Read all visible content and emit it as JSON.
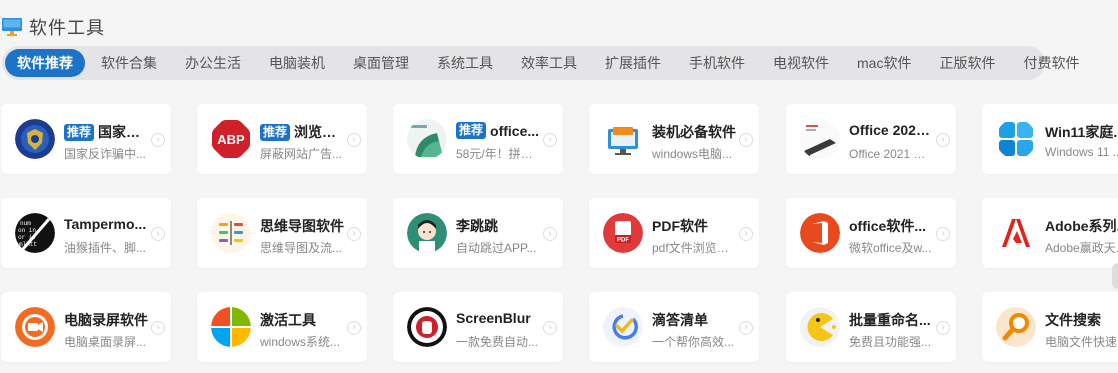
{
  "section": {
    "title": "软件工具",
    "icon": "monitor-icon"
  },
  "tabs": [
    "软件推荐",
    "软件合集",
    "办公生活",
    "电脑装机",
    "桌面管理",
    "系统工具",
    "效率工具",
    "扩展插件",
    "手机软件",
    "电视软件",
    "mac软件",
    "正版软件",
    "付费软件"
  ],
  "active_tab": "软件推荐",
  "accent_color": "#1c73c8",
  "cards": [
    {
      "name": "国家反...",
      "desc": "国家反诈骗中...",
      "badge": "推荐",
      "icon": "anti-fraud-shield-icon"
    },
    {
      "name": "浏览器...",
      "desc": "屏蔽网站广告...",
      "badge": "推荐",
      "icon": "adblock-plus-icon"
    },
    {
      "name": "office...",
      "desc": "58元/年！拼团...",
      "badge": "推荐",
      "icon": "microsoft-365-icon"
    },
    {
      "name": "装机必备软件",
      "desc": "windows电脑...",
      "badge": "",
      "icon": "toolbox-monitor-icon"
    },
    {
      "name": "Office 2021...",
      "desc": "Office 2021 家...",
      "badge": "",
      "icon": "office-box-icon"
    },
    {
      "name": "Win11家庭...",
      "desc": "Windows 11 ...",
      "badge": "",
      "icon": "windows-logo-icon"
    },
    {
      "name": "Tampermo...",
      "desc": "油猴插件、脚...",
      "badge": "",
      "icon": "tampermonkey-icon"
    },
    {
      "name": "思维导图软件",
      "desc": "思维导图及流...",
      "badge": "",
      "icon": "mind-map-icon"
    },
    {
      "name": "李跳跳",
      "desc": "自动跳过APP...",
      "badge": "",
      "icon": "avatar-girl-icon"
    },
    {
      "name": "PDF软件",
      "desc": "pdf文件浏览编...",
      "badge": "",
      "icon": "pdf-icon"
    },
    {
      "name": "office软件...",
      "desc": "微软office及w...",
      "badge": "",
      "icon": "office-logo-icon"
    },
    {
      "name": "Adobe系列...",
      "desc": "Adobe赢政天...",
      "badge": "",
      "icon": "adobe-logo-icon"
    },
    {
      "name": "电脑录屏软件",
      "desc": "电脑桌面录屏...",
      "badge": "",
      "icon": "screen-recorder-icon"
    },
    {
      "name": "激活工具",
      "desc": "windows系统...",
      "badge": "",
      "icon": "windows-color-icon"
    },
    {
      "name": "ScreenBlur",
      "desc": "一款免费自动...",
      "badge": "",
      "icon": "screenblur-stop-icon"
    },
    {
      "name": "滴答清单",
      "desc": "一个帮你高效...",
      "badge": "",
      "icon": "checkmark-icon"
    },
    {
      "name": "批量重命名...",
      "desc": "免费且功能强...",
      "badge": "",
      "icon": "pacman-icon"
    },
    {
      "name": "文件搜索",
      "desc": "电脑文件快速...",
      "badge": "",
      "icon": "magnifier-icon"
    }
  ]
}
